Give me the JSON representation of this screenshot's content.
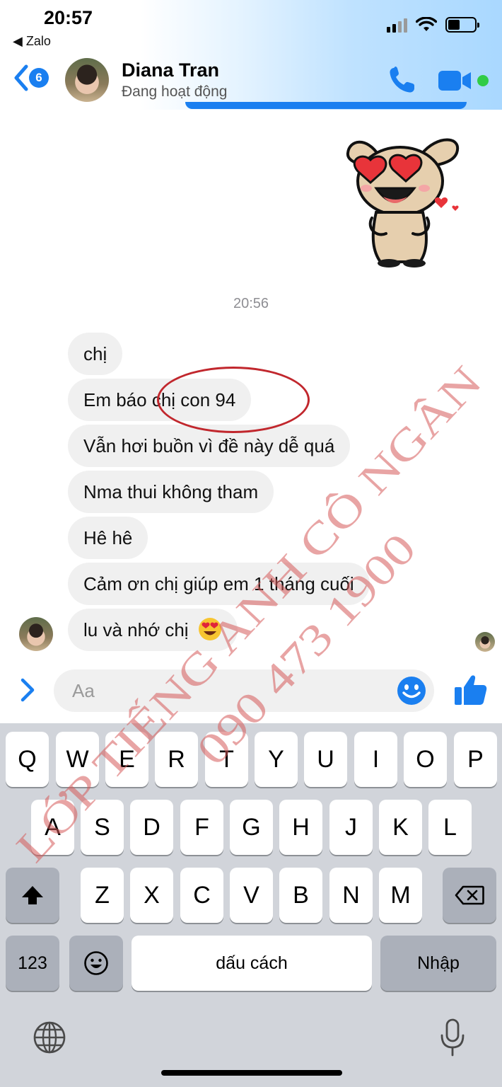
{
  "status_bar": {
    "time": "20:57",
    "back_app": "◀ Zalo"
  },
  "header": {
    "unread_count": "6",
    "contact_name": "Diana Tran",
    "contact_status": "Đang hoạt động",
    "icons": [
      "chevron-left-icon",
      "phone-icon",
      "video-camera-icon"
    ],
    "accent_color": "#1a7ff0",
    "online_color": "#31cc46"
  },
  "chat": {
    "timestamp": "20:56",
    "messages": [
      "chị",
      "Em báo chị con 94",
      "Vẫn hơi buồn vì đề này dễ quá",
      "Nma thui không tham",
      "Hê hê",
      "Cảm ơn chị giúp em 1 tháng cuối",
      "lu và nhớ chị"
    ]
  },
  "composer": {
    "placeholder": "Aa",
    "value": ""
  },
  "keyboard": {
    "row1": [
      "Q",
      "W",
      "E",
      "R",
      "T",
      "Y",
      "U",
      "I",
      "O",
      "P"
    ],
    "row2": [
      "A",
      "S",
      "D",
      "F",
      "G",
      "H",
      "J",
      "K",
      "L"
    ],
    "row3": [
      "Z",
      "X",
      "C",
      "V",
      "B",
      "N",
      "M"
    ],
    "numbers_label": "123",
    "space_label": "dấu cách",
    "return_label": "Nhập"
  },
  "watermark": {
    "line1": "LỚP TIẾNG ANH CÔ NGÂN",
    "line2": "090 473 1900",
    "color": "#d65a5a"
  }
}
